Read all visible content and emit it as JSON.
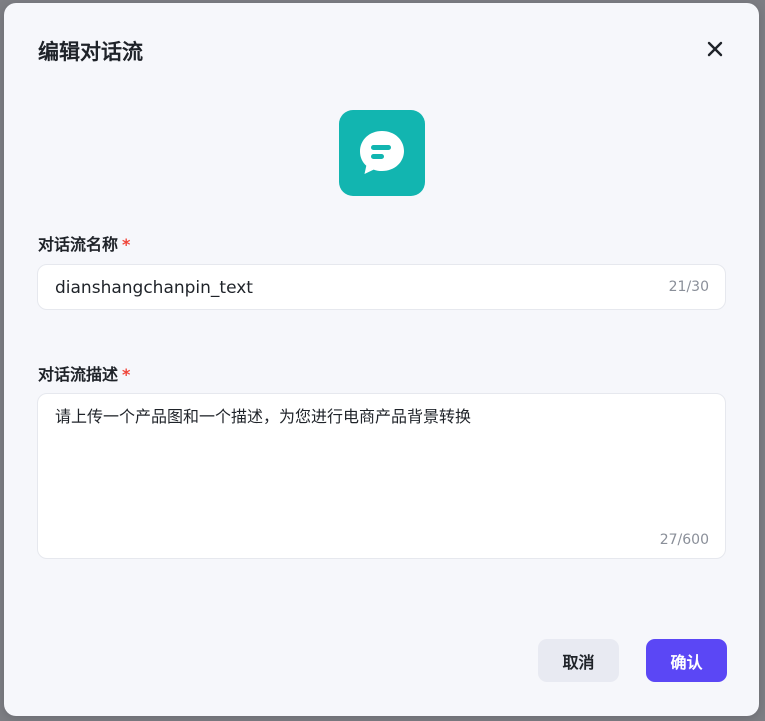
{
  "dialog": {
    "title": "编辑对话流",
    "close_icon": "close-icon",
    "app_icon": {
      "name": "chat-bubble-icon",
      "background": "#12b5b0"
    }
  },
  "form": {
    "name_field": {
      "label": "对话流名称",
      "required_mark": "*",
      "value": "dianshangchanpin_text",
      "counter": "21/30"
    },
    "description_field": {
      "label": "对话流描述",
      "required_mark": "*",
      "value": "请上传一个产品图和一个描述，为您进行电商产品背景转换",
      "counter": "27/600"
    }
  },
  "actions": {
    "cancel_label": "取消",
    "confirm_label": "确认",
    "confirm_color": "#5b47f5"
  }
}
